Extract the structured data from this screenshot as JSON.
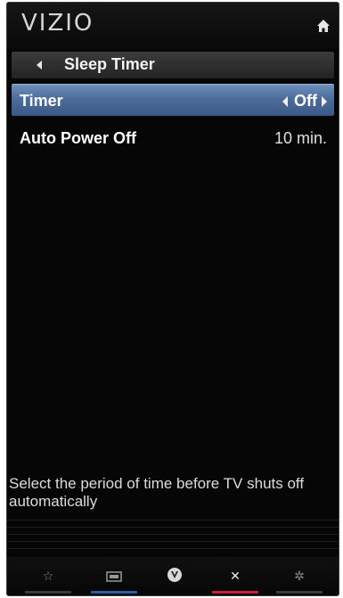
{
  "header": {
    "logo": "VIZIO",
    "home_icon": "home-icon"
  },
  "breadcrumb": {
    "back_icon": "back-arrow-icon",
    "title": "Sleep Timer"
  },
  "menu": {
    "items": [
      {
        "label": "Timer",
        "value": "Off",
        "selected": true
      },
      {
        "label": "Auto Power Off",
        "value": "10 min.",
        "selected": false
      }
    ]
  },
  "help": {
    "text": "Select the period of time before TV shuts off automatically"
  },
  "bottom_bar": {
    "items": [
      {
        "icon": "star-icon",
        "glyph": "☆",
        "underline_color": "#3a3a3a"
      },
      {
        "icon": "input-icon",
        "glyph": "▭",
        "underline_color": "#2d5fa8"
      },
      {
        "icon": "vizio-v-icon",
        "glyph": "V",
        "underline_color": ""
      },
      {
        "icon": "close-icon",
        "glyph": "✕",
        "underline_color": "#c8203a"
      },
      {
        "icon": "gear-icon",
        "glyph": "✲",
        "underline_color": "#3a3a3a"
      }
    ]
  },
  "colors": {
    "selected_row": "#4c6c9a",
    "background": "#060606"
  }
}
